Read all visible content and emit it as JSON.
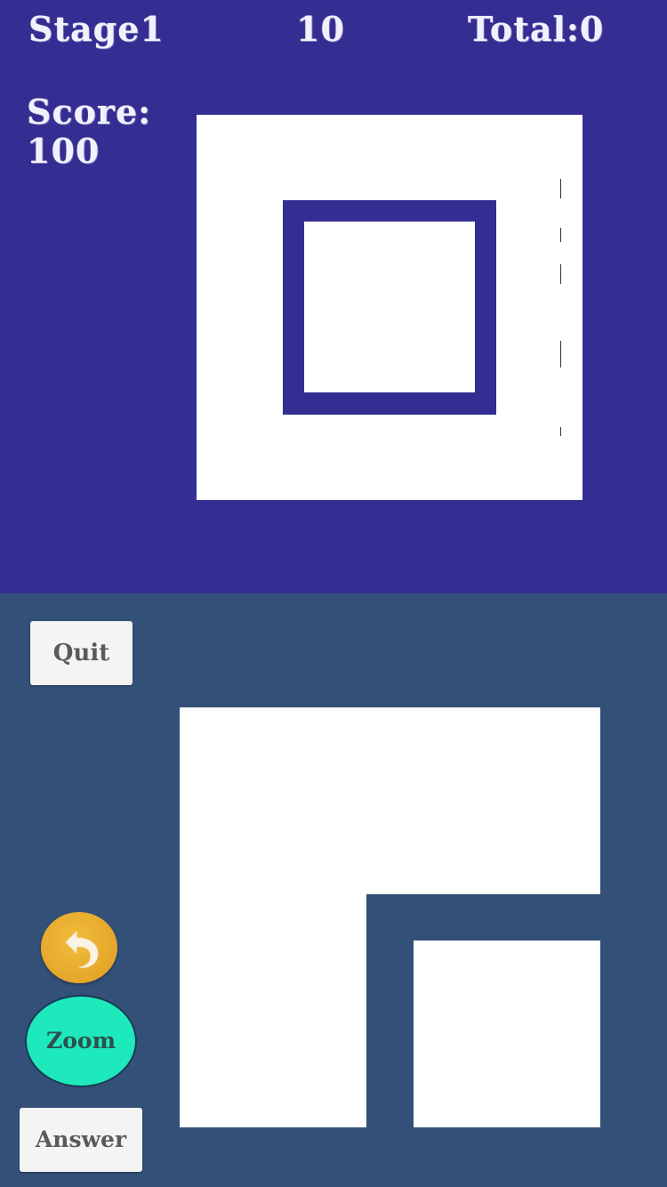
{
  "hud": {
    "stage": "Stage1",
    "timer": "10",
    "total": "Total:0",
    "score_label": "Score:",
    "score_value": "100"
  },
  "buttons": {
    "quit": "Quit",
    "zoom": "Zoom",
    "answer": "Answer",
    "undo_icon": "undo-arrow-icon"
  },
  "colors": {
    "top_background": "#342e92",
    "bottom_background": "#335079",
    "shape": "#ffffff",
    "undo_button": "#e5a62a",
    "zoom_button": "#1ee9bc"
  }
}
